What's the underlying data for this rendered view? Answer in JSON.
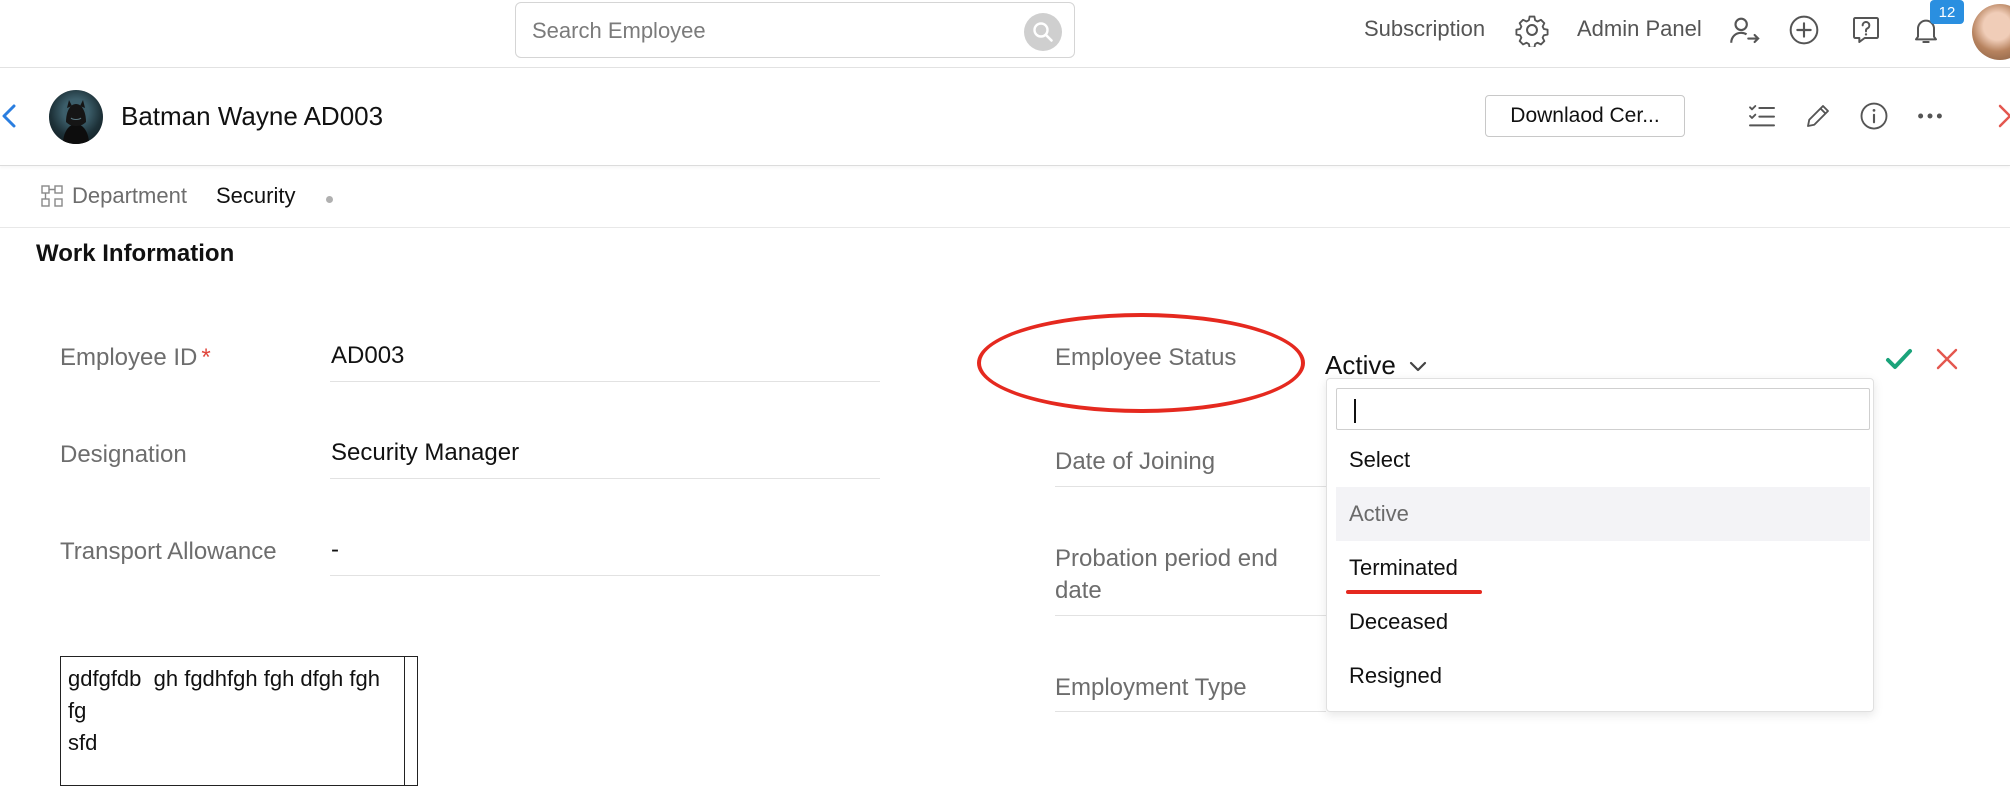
{
  "topbar": {
    "search_placeholder": "Search Employee",
    "subscription_label": "Subscription",
    "admin_panel_label": "Admin Panel",
    "notification_count": "12"
  },
  "header": {
    "employee_name": "Batman Wayne AD003",
    "download_button_label": "Downlaod Cer..."
  },
  "department": {
    "label": "Department",
    "value": "Security"
  },
  "work_information": {
    "title": "Work Information",
    "fields_left": [
      {
        "label": "Employee ID",
        "required_marker": "*",
        "value": "AD003"
      },
      {
        "label": "Designation",
        "value": "Security Manager"
      },
      {
        "label": "Transport Allowance",
        "value": "-"
      }
    ],
    "fields_right": [
      {
        "label": "Employee Status",
        "value": "Active"
      },
      {
        "label": "Date of Joining"
      },
      {
        "label_line1": "Probation period end",
        "label_line2": "date"
      },
      {
        "label": "Employment Type"
      }
    ],
    "notes_lines": [
      "gdfgfdb  gh fgdhfgh fgh dfgh fgh",
      "fg",
      "sfd"
    ]
  },
  "status_dropdown": {
    "search_value": "",
    "options": [
      "Select",
      "Active",
      "Terminated",
      "Deceased",
      "Resigned"
    ],
    "highlighted_option": "Active"
  },
  "colors": {
    "annotation_red": "#e5291f",
    "confirm_green": "#1aa37a",
    "cancel_red": "#e4574f",
    "badge_blue": "#2a8fe0",
    "back_arrow_blue": "#2a7ee0"
  }
}
